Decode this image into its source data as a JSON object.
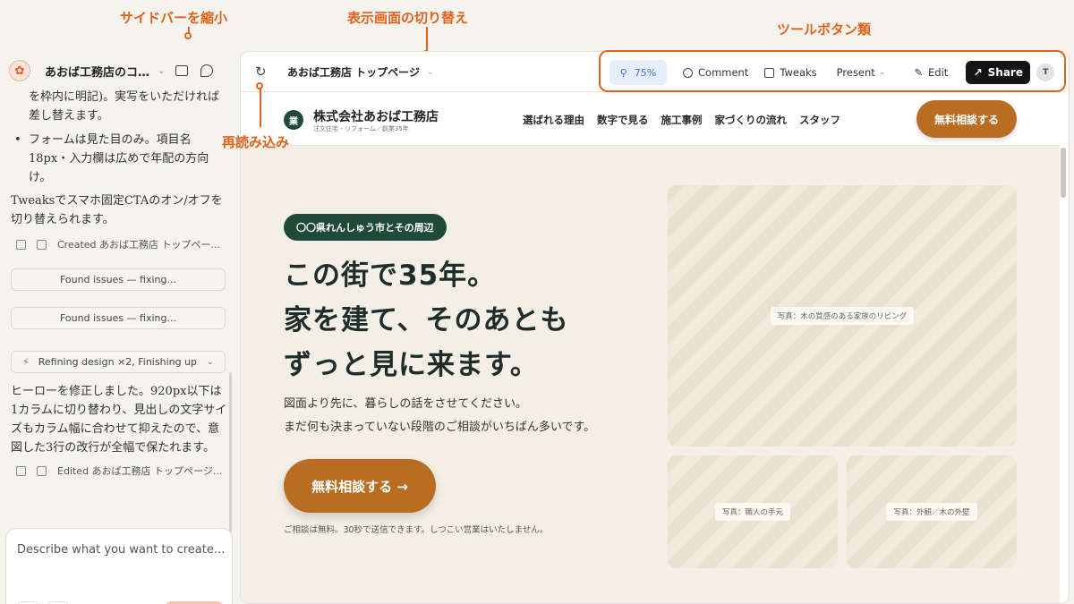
{
  "annotations": {
    "sidebar_toggle": "サイドバーを縮小",
    "view_switch": "表示画面の切り替え",
    "tool_buttons": "ツールボタン類",
    "reload": "再読み込み"
  },
  "left_panel": {
    "project_title": "あおば工務店のコ...",
    "messages": {
      "para1": "を枠内に明記)。実写をいただければ差し替えます。",
      "bullet1": "フォームは見た目のみ。項目名 18px・入力欄は広めで年配の方向け。",
      "para2": "Tweaksでスマホ固定CTAのオン/オフを切り替えられます。",
      "created": "Created あおば工務店 トップペー...",
      "found1": "Found issues — fixing...",
      "found2": "Found issues — fixing...",
      "refining": "Refining design ×2, Finishing up",
      "para3": "ヒーローを修正しました。920px以下は1カラムに切り替わり、見出しの文字サイズもカラム幅に合わせて抑えたので、意図した3行の改行が全幅で保たれます。",
      "edited": "Edited あおば工務店 トップページ..."
    },
    "composer_placeholder": "Describe what you want to create..."
  },
  "toolbar": {
    "page_title": "あおば工務店 トップページ",
    "zoom": "75%",
    "comment": "Comment",
    "tweaks": "Tweaks",
    "present": "Present",
    "edit": "Edit",
    "share": "Share",
    "avatar": "T"
  },
  "site": {
    "logo_char": "業",
    "company_name": "株式会社あおば工務店",
    "company_sub": "注文住宅・リフォーム／創業35年",
    "nav": [
      "選ばれる理由",
      "数字で見る",
      "施工事例",
      "家づくりの流れ",
      "スタッフ"
    ],
    "header_cta": "無料相談する",
    "badge": "〇〇県れんしゅう市とその周辺",
    "headline": [
      "この街で35年。",
      "家を建て、そのあとも",
      "ずっと見に来ます。"
    ],
    "lead": [
      "図面より先に、暮らしの話をさせてください。",
      "まだ何も決まっていない段階のご相談がいちばん多いです。"
    ],
    "hero_cta": "無料相談する →",
    "note": "ご相談は無料。30秒で送信できます。しつこい営業はいたしません。",
    "photo_main": "写真：木の質感のある家族のリビング",
    "photo_sub1": "写真：職人の手元",
    "photo_sub2": "写真：外観／木の外壁"
  },
  "colors": {
    "accent": "#e0621b",
    "brand_green": "#1f4a3a",
    "cta_brown": "#b86d23",
    "zoom_blue": "#3b6fd6"
  }
}
